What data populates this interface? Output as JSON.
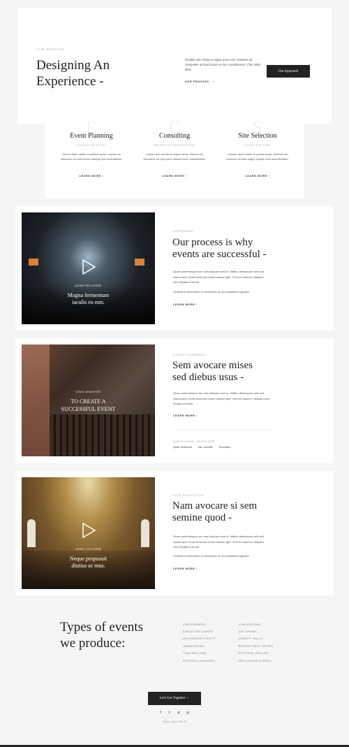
{
  "hero": {
    "eyebrow": "OUR SERVICES",
    "title_line1": "Designing An",
    "title_line2": "Experience -",
    "text": "Reddite ante tridua et regiae quae eros. Eusdem ab competere ad trust harum et iure constituemus. Clari nihilo alias.",
    "link": "OUR PROCESS",
    "button": "Our Approach"
  },
  "services": [
    {
      "letter": "E",
      "title": "Event Planning",
      "tag": "INNOVATION IS KEY",
      "desc": "Sanvol diam habits et quidem quae. Capere ac ditsurnus na velit harum daequit orci adversitates.",
      "link": "LEARN MORE"
    },
    {
      "letter": "C",
      "title": "Consulting",
      "tag": "BRANDS & CORPORATIONS",
      "desc": "Corpori ado merito te neque nemo. Renovo ac eisumene ea dicit perro missae enim conscientias.",
      "link": "LEARN MORE"
    },
    {
      "letter": "S",
      "title": "Site Selection",
      "tag": "SAVES THE TIME",
      "desc": "Invener modi muller te porsita quae. Eiusrum ad excidere ad fidei augue possim eius obsedientiam.",
      "link": "LEARN MORE"
    }
  ],
  "features": [
    {
      "photo_caption_small": "QUAM PELLENSE",
      "photo_caption_line1": "Magna fermentum",
      "photo_caption_line2": "iaculis eu non.",
      "eyebrow": "APPROACH",
      "title_line1": "Our process is why",
      "title_line2": "events are successful -",
      "para1": "Quam pellentesque nec nam aliquam sem et. Mattis ullamcorper velit sed ullamcorper morbi tincidunt ornare massa eget. Viverra mauris in aliquam sem fringilla ut morbi.",
      "para2": "Gravida in fermentum et sollicitudin ac orci phasellus egestas.",
      "link": "LEARN MORE"
    },
    {
      "photo_caption_small": "CRAS MINISTER",
      "photo_caption_line1": "TO CREATE A",
      "photo_caption_line2": "SUCCESSFUL EVENT",
      "eyebrow": "EVENT PLANNING",
      "title_line1": "Sem avocare mises",
      "title_line2": "sed diebus usus -",
      "para1": "Quam pellentesque nec nam aliquam sem et. Mattis ullamcorper velit sed ullamcorper morbi tincidunt ornare massa eget. Viverra mauris in aliquam sem fringilla ut morbi.",
      "link": "LEARN MORE",
      "extra_eyebrow": "ADDITIONAL SERVICES",
      "extras": [
        "Quad Vesibnum",
        "Ilai Convallit",
        "Excepteur"
      ]
    },
    {
      "photo_caption_small": "HERO VICTIOUM",
      "photo_caption_line1": "Neque proposuit",
      "photo_caption_line2": "diutius ac mus.",
      "eyebrow": "SITE SELECTION",
      "title_line1": "Nam avocare si sem",
      "title_line2": "semine quod -",
      "para1": "Quam pellentesque nec nam aliquam sem et. Mattis ullamcorper velit sed ullamcorper morbi tincidunt ornare massa eget. Viverra mauris in aliquam sem fringilla ut morbi.",
      "para2": "Gravida in fermentum et sollicitudin ac orci phasellus egestas.",
      "link": "LEARN MORE"
    }
  ],
  "types": {
    "title_line1": "Types of events",
    "title_line2": "we produce:",
    "col1": [
      "CONFERENCES",
      "EXECUTIVE EVENTS",
      "INFLUENCER EVENTS",
      "TRADESHOWS",
      "TEAM BUILDING",
      "PRODUCT LAUNCHES"
    ],
    "col2": [
      "CONVENTIONS",
      "ART SHOWS",
      "CHARITY BALLS",
      "RECRUITMENT DRIVES",
      "POLITICAL RALLIES",
      "INFLUENCER EVENTS"
    ]
  },
  "footer": {
    "cta": "Let's Get Together —",
    "social": [
      {
        "icon": "facebook-icon",
        "glyph": "f"
      },
      {
        "icon": "twitter-icon",
        "glyph": "t"
      },
      {
        "icon": "pinterest-icon",
        "glyph": "p"
      },
      {
        "icon": "instagram-icon",
        "glyph": "◎"
      }
    ],
    "tagline": "Follow, Share, Pin Us"
  },
  "colors": {
    "dark": "#222222",
    "bg": "#f5f5f5",
    "card": "#ffffff"
  }
}
